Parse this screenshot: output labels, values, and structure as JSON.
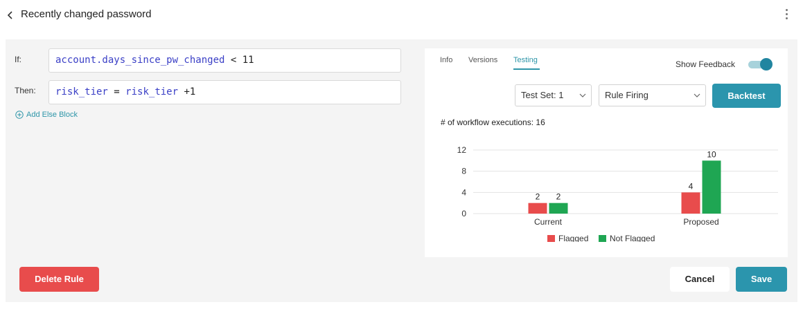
{
  "header": {
    "title": "Recently changed password"
  },
  "rule": {
    "if_label": "If:",
    "then_label": "Then:",
    "if_expr": {
      "lhs": "account.days_since_pw_changed",
      "op": "<",
      "rhs": "11"
    },
    "then_expr": {
      "lhs": "risk_tier",
      "op": "=",
      "rhs_var": "risk_tier",
      "rhs_rest": "+1"
    },
    "add_else": "Add Else Block"
  },
  "tabs": [
    {
      "label": "Info"
    },
    {
      "label": "Versions"
    },
    {
      "label": "Testing",
      "active": true
    }
  ],
  "feedback": {
    "label": "Show Feedback",
    "enabled": true
  },
  "controls": {
    "test_set": "Test Set: 1",
    "mode": "Rule Firing",
    "backtest": "Backtest"
  },
  "exec_label": "# of workflow executions: 16",
  "chart_data": {
    "type": "bar",
    "categories": [
      "Current",
      "Proposed"
    ],
    "series": [
      {
        "name": "Flagged",
        "values": [
          2,
          4
        ],
        "color": "#e84c4c"
      },
      {
        "name": "Not Flagged",
        "values": [
          2,
          10
        ],
        "color": "#1fa653"
      }
    ],
    "yticks": [
      0,
      4,
      8,
      12
    ],
    "ylim": [
      0,
      12
    ],
    "grid": true,
    "legend": "bottom"
  },
  "actions": {
    "delete": "Delete Rule",
    "cancel": "Cancel",
    "save": "Save"
  },
  "colors": {
    "accent": "#2b95ad",
    "danger": "#e84c4c",
    "keyword": "#3a3fc6"
  }
}
